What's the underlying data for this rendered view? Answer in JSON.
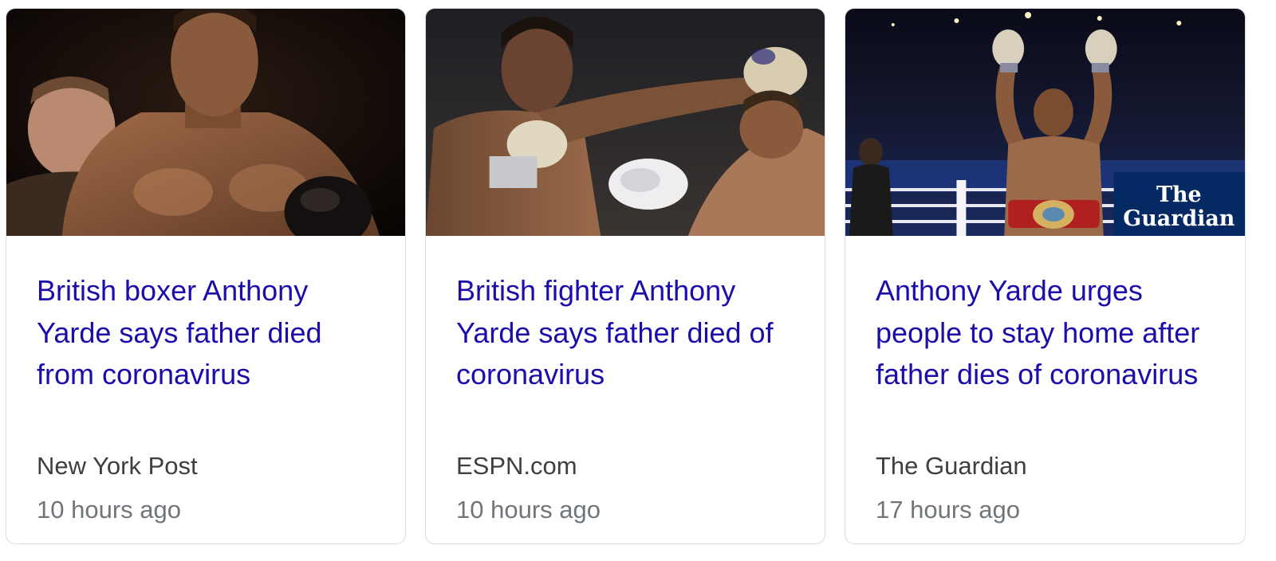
{
  "colors": {
    "headline": "#1a0dab",
    "source": "#3c4043",
    "time": "#70757a",
    "card_border": "#dadce0"
  },
  "cards": [
    {
      "headline": "British boxer Anthony Yarde says father died from coronavirus",
      "source": "New York Post",
      "time": "10 hours ago",
      "image": "boxer-portrait-photo"
    },
    {
      "headline": "British fighter Anthony Yarde says father died of coronavirus",
      "source": "ESPN.com",
      "time": "10 hours ago",
      "image": "boxing-punch-photo"
    },
    {
      "headline": "Anthony Yarde urges people to stay home after father dies of coronavirus",
      "source": "The Guardian",
      "time": "17 hours ago",
      "image": "boxer-victory-photo",
      "image_watermark": "The Guardian"
    }
  ]
}
